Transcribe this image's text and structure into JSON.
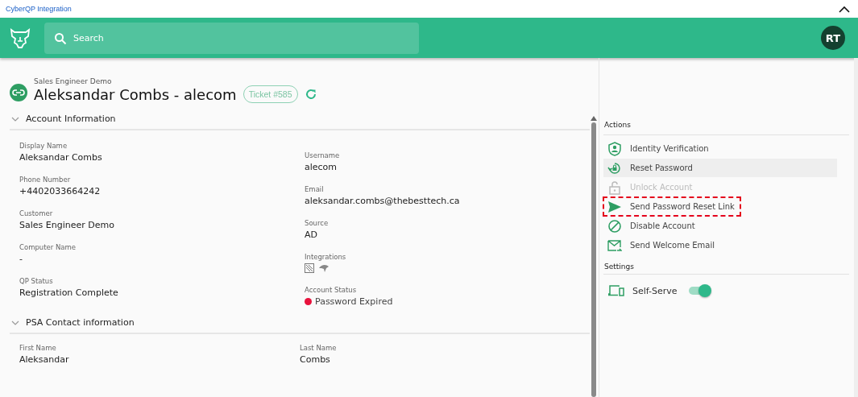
{
  "window": {
    "title": "CyberQP Integration",
    "collapsed": false
  },
  "header": {
    "search": {
      "placeholder": "Search"
    },
    "avatar": "RT"
  },
  "page": {
    "customer": "Sales Engineer Demo",
    "title": "Aleksandar Combs - alecom",
    "ticket": "Ticket #585"
  },
  "sections": [
    {
      "title": "Account Information",
      "expanded": true,
      "columns": [
        [
          {
            "kind": "text",
            "label": "Display Name",
            "value": "Aleksandar Combs"
          },
          {
            "kind": "text",
            "label": "Phone Number",
            "value": "+4402033664242"
          },
          {
            "kind": "text",
            "label": "Customer",
            "value": "Sales Engineer Demo"
          },
          {
            "kind": "text",
            "label": "Computer Name",
            "value": "-"
          },
          {
            "kind": "text",
            "label": "QP Status",
            "value": "Registration Complete"
          }
        ],
        [
          {
            "kind": "text",
            "label": "Username",
            "value": "alecom"
          },
          {
            "kind": "text",
            "label": "Email",
            "value": "aleksandar.combs@thebesttech.ca"
          },
          {
            "kind": "text",
            "label": "Source",
            "value": "AD"
          },
          {
            "kind": "icons",
            "label": "Integrations"
          },
          {
            "kind": "status",
            "label": "Account Status",
            "value": "Password Expired",
            "color": "#e8123c"
          }
        ]
      ]
    },
    {
      "title": "PSA Contact information",
      "expanded": true,
      "columns": [
        [
          {
            "kind": "text",
            "label": "First Name",
            "value": "Aleksandar"
          }
        ],
        [
          {
            "kind": "text",
            "label": "Last Name",
            "value": "Combs"
          }
        ]
      ]
    }
  ],
  "actions": {
    "title": "Actions",
    "items": [
      {
        "kind": "identity",
        "label": "Identity Verification",
        "selected": false,
        "disabled": false,
        "highlighted": false
      },
      {
        "kind": "reset",
        "label": "Reset Password",
        "selected": true,
        "disabled": false,
        "highlighted": false
      },
      {
        "kind": "unlock",
        "label": "Unlock Account",
        "selected": false,
        "disabled": true,
        "highlighted": false
      },
      {
        "kind": "send",
        "label": "Send Password Reset Link",
        "selected": false,
        "disabled": false,
        "highlighted": true
      },
      {
        "kind": "disable",
        "label": "Disable Account",
        "selected": false,
        "disabled": false,
        "highlighted": false
      },
      {
        "kind": "email",
        "label": "Send Welcome Email",
        "selected": false,
        "disabled": false,
        "highlighted": false
      }
    ]
  },
  "settings": {
    "title": "Settings",
    "items": [
      {
        "label": "Self-Serve",
        "on": true
      }
    ]
  }
}
